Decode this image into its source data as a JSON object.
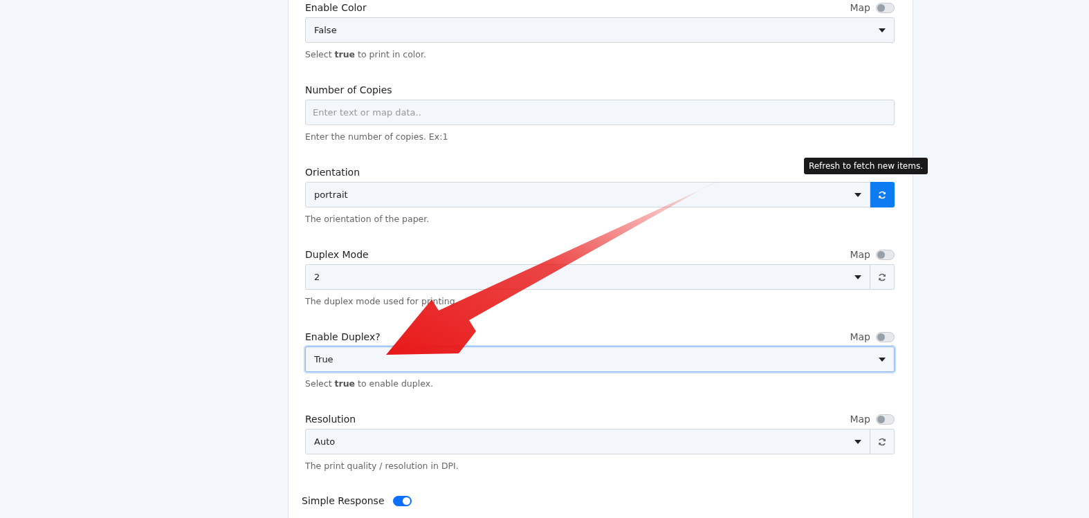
{
  "fields": [
    {
      "label": "Enable Color",
      "kind": "select",
      "value": "False",
      "map": {
        "label": "Map",
        "on": false
      },
      "focused": false,
      "help": "Select **true** to print in color."
    },
    {
      "label": "Number of Copies",
      "kind": "text",
      "placeholder": "Enter text or map data..",
      "focused": false,
      "help": "Enter the number of copies. Ex:1"
    },
    {
      "label": "Orientation",
      "kind": "select",
      "value": "portrait",
      "focused": false,
      "refresh_button": {
        "kind": "primary"
      },
      "tooltip": "Refresh to fetch new items.",
      "help": "The orientation of the paper."
    },
    {
      "label": "Duplex Mode",
      "kind": "select",
      "value": "2",
      "map": {
        "label": "Map",
        "on": false
      },
      "focused": false,
      "refresh_button": {
        "kind": "plain"
      },
      "help": "The duplex mode used for printing."
    },
    {
      "label": "Enable Duplex?",
      "kind": "select",
      "value": "True",
      "map": {
        "label": "Map",
        "on": false
      },
      "focused": true,
      "help": "Select **true** to enable duplex."
    },
    {
      "label": "Resolution",
      "kind": "select",
      "value": "Auto",
      "map": {
        "label": "Map",
        "on": false
      },
      "focused": false,
      "refresh_button": {
        "kind": "plain"
      },
      "help": "The print quality / resolution in DPI."
    }
  ],
  "simple_response": {
    "label": "Simple Response",
    "on": true
  }
}
